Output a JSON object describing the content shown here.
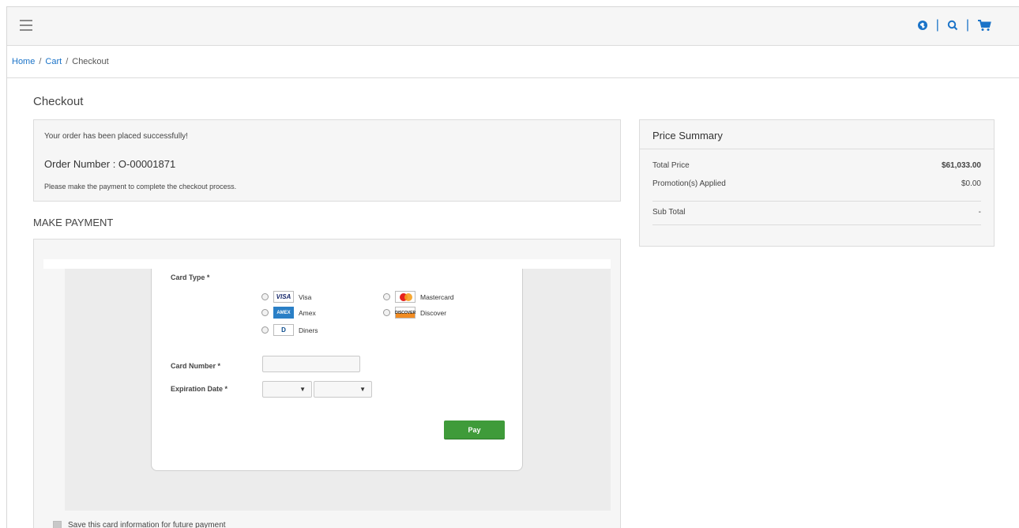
{
  "header": {
    "menu_icon": "hamburger-icon",
    "icons": [
      "globe-icon",
      "search-icon",
      "cart-icon"
    ],
    "separator": "|"
  },
  "breadcrumb": {
    "items": [
      "Home",
      "Cart",
      "Checkout"
    ],
    "separator": "/"
  },
  "page": {
    "title": "Checkout"
  },
  "order": {
    "success_message": "Your order has been placed successfully!",
    "order_number": "Order Number : O-00001871",
    "note": "Please make the payment to complete the checkout process."
  },
  "payment": {
    "section_title": "MAKE PAYMENT",
    "card_type_label": "Card Type *",
    "card_types": [
      {
        "label": "Visa",
        "logo": "VISA"
      },
      {
        "label": "Mastercard",
        "logo": ""
      },
      {
        "label": "Amex",
        "logo": "AMEX"
      },
      {
        "label": "Discover",
        "logo": "DISCOVER"
      },
      {
        "label": "Diners",
        "logo": "D"
      }
    ],
    "card_number_label": "Card Number *",
    "card_number_value": "",
    "expiration_label": "Expiration Date *",
    "exp_month_value": "",
    "exp_year_value": "",
    "pay_label": "Pay",
    "save_card_label": "Save this card information for future payment"
  },
  "summary": {
    "title": "Price Summary",
    "rows": [
      {
        "label": "Total Price",
        "value": "$61,033.00"
      },
      {
        "label": "Promotion(s) Applied",
        "value": "$0.00"
      }
    ],
    "subtotal_label": "Sub Total",
    "subtotal_value": "-"
  },
  "colors": {
    "accent": "#1a73c8",
    "pay_button": "#3f9b3a"
  }
}
